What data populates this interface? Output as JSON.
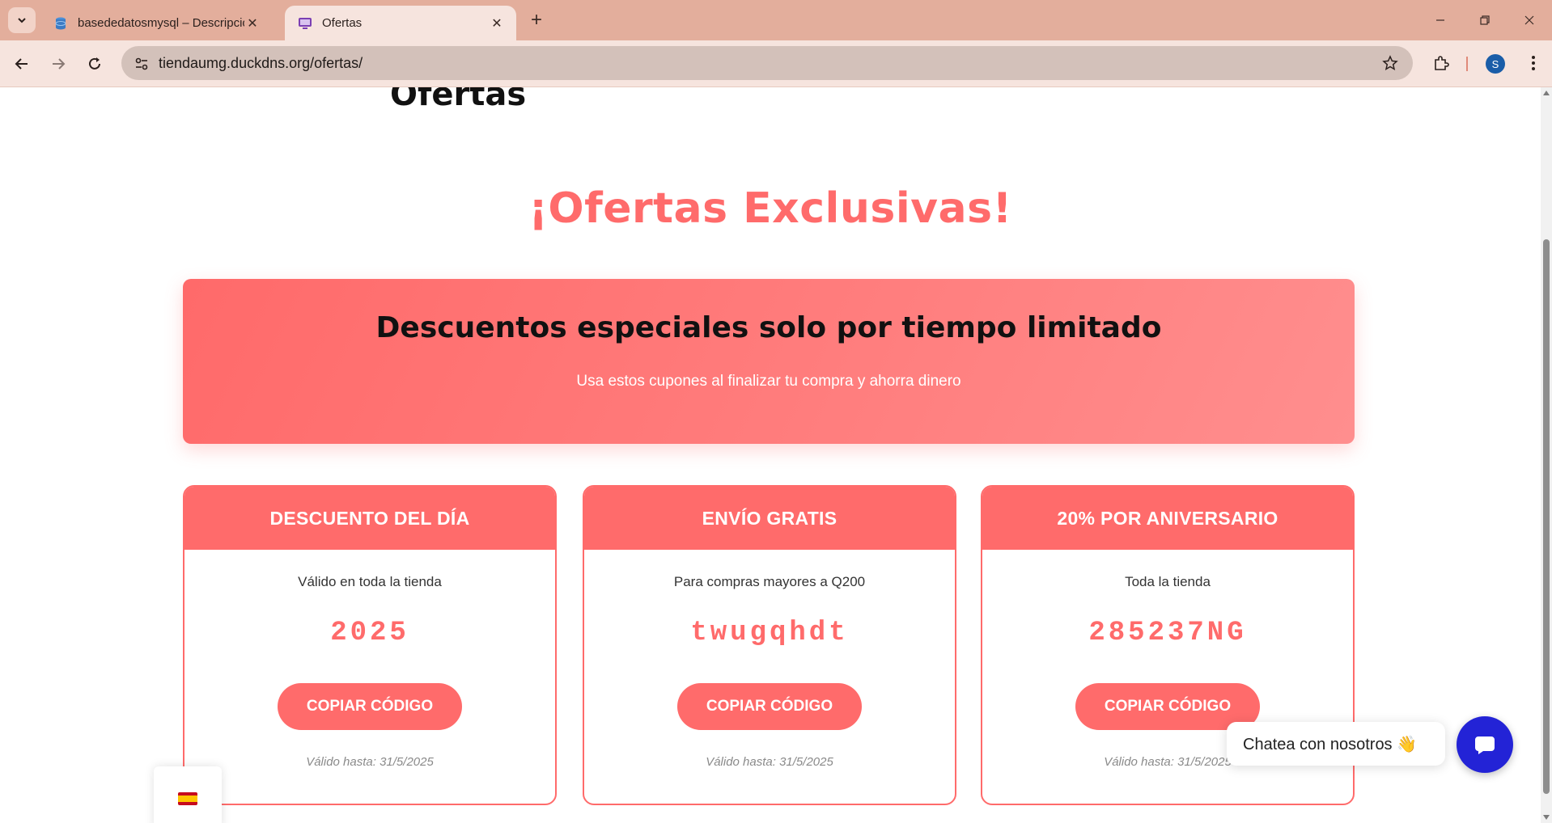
{
  "browser": {
    "tabs": [
      {
        "title": "basededatosmysql – Descripción",
        "active": false
      },
      {
        "title": "Ofertas",
        "active": true
      }
    ],
    "url": "tiendaumg.duckdns.org/ofertas/",
    "profile_initial": "S"
  },
  "page": {
    "header_title": "Ofertas",
    "hero_title": "¡Ofertas Exclusivas!",
    "banner": {
      "title": "Descuentos especiales solo por tiempo limitado",
      "subtitle": "Usa estos cupones al finalizar tu compra y ahorra dinero"
    },
    "cards": [
      {
        "title": "DESCUENTO DEL DÍA",
        "description": "Válido en toda la tienda",
        "code": "2025",
        "button": "COPIAR CÓDIGO",
        "valid": "Válido hasta: 31/5/2025"
      },
      {
        "title": "ENVÍO GRATIS",
        "description": "Para compras mayores a Q200",
        "code": "twugqhdt",
        "button": "COPIAR CÓDIGO",
        "valid": "Válido hasta: 31/5/2025"
      },
      {
        "title": "20% POR ANIVERSARIO",
        "description": "Toda la tienda",
        "code": "285237NG",
        "button": "COPIAR CÓDIGO",
        "valid": "Válido hasta: 31/5/2025"
      }
    ],
    "chat": {
      "label": "Chatea con nosotros 👋"
    },
    "language_icon": "spain-flag-icon"
  },
  "colors": {
    "accent": "#ff6b6b",
    "chat": "#2323d6"
  }
}
